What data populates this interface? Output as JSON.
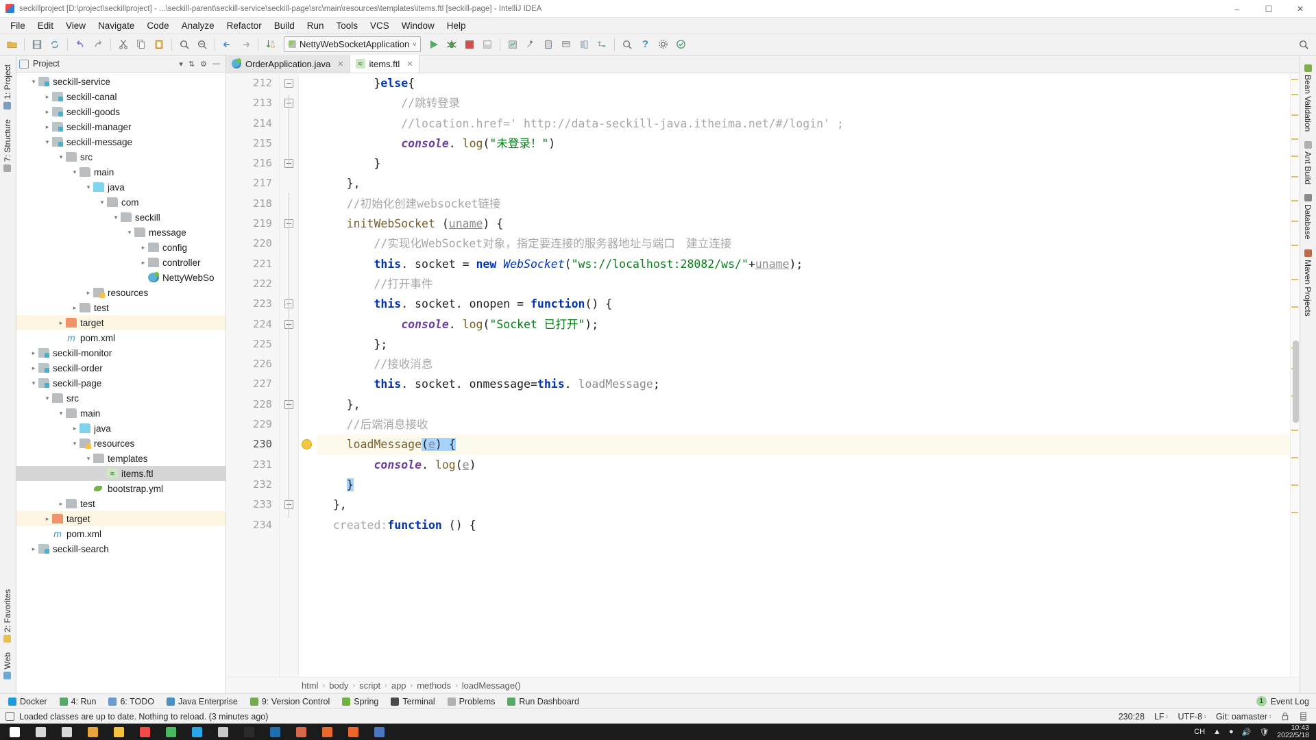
{
  "window": {
    "title": "seckillproject [D:\\project\\seckillproject] - ...\\seckill-parent\\seckill-service\\seckill-page\\src\\main\\resources\\templates\\items.ftl [seckill-page] - IntelliJ IDEA",
    "minimize": "–",
    "maximize": "☐",
    "close": "✕",
    "app_icon": "intellij-logo-icon"
  },
  "menubar": {
    "items": [
      {
        "label": "File"
      },
      {
        "label": "Edit"
      },
      {
        "label": "View"
      },
      {
        "label": "Navigate"
      },
      {
        "label": "Code"
      },
      {
        "label": "Analyze"
      },
      {
        "label": "Refactor"
      },
      {
        "label": "Build"
      },
      {
        "label": "Run"
      },
      {
        "label": "Tools"
      },
      {
        "label": "VCS"
      },
      {
        "label": "Window"
      },
      {
        "label": "Help"
      }
    ]
  },
  "toolbar": {
    "icons": [
      "open-folder-icon",
      "save-all-icon",
      "sync-icon",
      "undo-icon",
      "redo-icon",
      "cut-icon",
      "copy-icon",
      "paste-icon",
      "find-icon",
      "replace-icon",
      "back-icon",
      "forward-icon",
      "sort-icon"
    ],
    "run_config": {
      "label": "NettyWebSocketApplication",
      "dropdown": "˅",
      "icon": "run-config-icon"
    },
    "right_icons": [
      "run-icon",
      "debug-icon",
      "stop-icon",
      "coverage-icon",
      "profile-icon",
      "build-icon",
      "avd-icon",
      "sdk-icon",
      "layout-icon",
      "structure-icon",
      "search-everywhere-icon",
      "help-icon",
      "settings-icon",
      "inspect-icon"
    ],
    "search_icon": "magnifier-icon"
  },
  "left_rail": {
    "tabs": [
      {
        "label": "1: Project",
        "icon": "project-rail-icon"
      },
      {
        "label": "7: Structure",
        "icon": "structure-rail-icon"
      },
      {
        "label": "Web",
        "icon": "web-rail-icon"
      },
      {
        "label": "2: Favorites",
        "icon": "favorites-rail-icon"
      }
    ]
  },
  "right_rail": {
    "tabs": [
      {
        "label": "Bean Validation",
        "icon": "bean-validation-icon"
      },
      {
        "label": "Ant Build",
        "icon": "ant-build-icon"
      },
      {
        "label": "Database",
        "icon": "database-icon"
      },
      {
        "label": "Maven Projects",
        "icon": "maven-icon"
      }
    ]
  },
  "project_panel": {
    "title": "Project",
    "icon": "project-panel-icon",
    "actions": [
      "collapse-all-icon",
      "settings-icon",
      "hide-icon"
    ],
    "tree": [
      {
        "indent": 2,
        "chev": "down",
        "icon": "mod",
        "label": "seckill-service",
        "state": ""
      },
      {
        "indent": 3,
        "chev": "right",
        "icon": "mod",
        "label": "seckill-canal",
        "state": ""
      },
      {
        "indent": 3,
        "chev": "right",
        "icon": "mod",
        "label": "seckill-goods",
        "state": ""
      },
      {
        "indent": 3,
        "chev": "right",
        "icon": "mod",
        "label": "seckill-manager",
        "state": ""
      },
      {
        "indent": 3,
        "chev": "down",
        "icon": "mod",
        "label": "seckill-message",
        "state": ""
      },
      {
        "indent": 4,
        "chev": "down",
        "icon": "folder",
        "label": "src",
        "state": ""
      },
      {
        "indent": 5,
        "chev": "down",
        "icon": "folder",
        "label": "main",
        "state": ""
      },
      {
        "indent": 6,
        "chev": "down",
        "icon": "folderblue",
        "label": "java",
        "state": ""
      },
      {
        "indent": 7,
        "chev": "down",
        "icon": "folder",
        "label": "com",
        "state": ""
      },
      {
        "indent": 8,
        "chev": "down",
        "icon": "folder",
        "label": "seckill",
        "state": ""
      },
      {
        "indent": 9,
        "chev": "down",
        "icon": "folder",
        "label": "message",
        "state": ""
      },
      {
        "indent": 10,
        "chev": "right",
        "icon": "folder",
        "label": "config",
        "state": ""
      },
      {
        "indent": 10,
        "chev": "right",
        "icon": "folder",
        "label": "controller",
        "state": ""
      },
      {
        "indent": 10,
        "chev": "none",
        "icon": "java",
        "label": "NettyWebSo",
        "state": ""
      },
      {
        "indent": 6,
        "chev": "right",
        "icon": "res",
        "label": "resources",
        "state": ""
      },
      {
        "indent": 5,
        "chev": "right",
        "icon": "folder",
        "label": "test",
        "state": ""
      },
      {
        "indent": 4,
        "chev": "right",
        "icon": "orange",
        "label": "target",
        "state": "highlight"
      },
      {
        "indent": 4,
        "chev": "none",
        "icon": "pom",
        "label": "pom.xml",
        "state": ""
      },
      {
        "indent": 2,
        "chev": "right",
        "icon": "mod",
        "label": "seckill-monitor",
        "state": ""
      },
      {
        "indent": 2,
        "chev": "right",
        "icon": "mod",
        "label": "seckill-order",
        "state": ""
      },
      {
        "indent": 2,
        "chev": "down",
        "icon": "mod",
        "label": "seckill-page",
        "state": ""
      },
      {
        "indent": 3,
        "chev": "down",
        "icon": "folder",
        "label": "src",
        "state": ""
      },
      {
        "indent": 4,
        "chev": "down",
        "icon": "folder",
        "label": "main",
        "state": ""
      },
      {
        "indent": 5,
        "chev": "right",
        "icon": "folderblue",
        "label": "java",
        "state": ""
      },
      {
        "indent": 5,
        "chev": "down",
        "icon": "res",
        "label": "resources",
        "state": ""
      },
      {
        "indent": 6,
        "chev": "down",
        "icon": "folder",
        "label": "templates",
        "state": ""
      },
      {
        "indent": 7,
        "chev": "none",
        "icon": "ftl",
        "label": "items.ftl",
        "state": "selected"
      },
      {
        "indent": 6,
        "chev": "none",
        "icon": "yml",
        "label": "bootstrap.yml",
        "state": ""
      },
      {
        "indent": 4,
        "chev": "right",
        "icon": "folder",
        "label": "test",
        "state": ""
      },
      {
        "indent": 3,
        "chev": "right",
        "icon": "orange",
        "label": "target",
        "state": "highlight"
      },
      {
        "indent": 3,
        "chev": "none",
        "icon": "pom",
        "label": "pom.xml",
        "state": ""
      },
      {
        "indent": 2,
        "chev": "right",
        "icon": "mod",
        "label": "seckill-search",
        "state": ""
      }
    ]
  },
  "editor": {
    "tabs": [
      {
        "label": "OrderApplication.java",
        "icon": "java",
        "active": false,
        "close": "✕"
      },
      {
        "label": "items.ftl",
        "icon": "ftl",
        "active": true,
        "close": "✕"
      }
    ],
    "first_line_number": 212,
    "current_line": 230,
    "lines": [
      {
        "n": 212,
        "html": "<span class='tk-plain'>        }</span><span class='tk-kw'>else</span><span class='tk-plain'>{</span>"
      },
      {
        "n": 213,
        "html": "<span class='tk-cm'>            //跳转登录</span>"
      },
      {
        "n": 214,
        "html": "<span class='tk-cm'>            //location.href=' http://data-seckill-java.itheima.net/#/login' ;</span>"
      },
      {
        "n": 215,
        "html": "<span class='tk-plain'>            </span><span class='tk-con'>console</span><span class='tk-plain'>. </span><span class='tk-fn'>log</span><span class='tk-plain'>(</span><span class='tk-str'>\"未登录！\"</span><span class='tk-plain'>)</span>"
      },
      {
        "n": 216,
        "html": "<span class='tk-plain'>        }</span>"
      },
      {
        "n": 217,
        "html": "<span class='tk-plain'>    },</span>"
      },
      {
        "n": 218,
        "html": "<span class='tk-cm'>    //初始化创建websocket链接</span>"
      },
      {
        "n": 219,
        "html": "<span class='tk-plain'>    </span><span class='tk-fn'>initWebSocket</span><span class='tk-plain'> (</span><span class='tk-field tk-ul'>uname</span><span class='tk-plain'>) {</span>"
      },
      {
        "n": 220,
        "html": "<span class='tk-cm'>        //实现化WebSocket对象，指定要连接的服务器地址与端口　建立连接</span>"
      },
      {
        "n": 221,
        "html": "<span class='tk-plain'>        </span><span class='tk-kw'>this</span><span class='tk-plain'>. socket = </span><span class='tk-kw'>new</span><span class='tk-plain'> </span><span class='tk-cls'>WebSocket</span><span class='tk-plain'>(</span><span class='tk-str'>\"ws://localhost:28082/ws/\"</span><span class='tk-plain'>+</span><span class='tk-field tk-ul'>uname</span><span class='tk-plain'>);</span>"
      },
      {
        "n": 222,
        "html": "<span class='tk-cm'>        //打开事件</span>"
      },
      {
        "n": 223,
        "html": "<span class='tk-plain'>        </span><span class='tk-kw'>this</span><span class='tk-plain'>. socket. </span><span class='tk-plain'>onopen = </span><span class='tk-kw'>function</span><span class='tk-plain'>() {</span>"
      },
      {
        "n": 224,
        "html": "<span class='tk-plain'>            </span><span class='tk-con'>console</span><span class='tk-plain'>. </span><span class='tk-fn'>log</span><span class='tk-plain'>(</span><span class='tk-str'>\"Socket 已打开\"</span><span class='tk-plain'>);</span>"
      },
      {
        "n": 225,
        "html": "<span class='tk-plain'>        };</span>"
      },
      {
        "n": 226,
        "html": "<span class='tk-cm'>        //接收消息</span>"
      },
      {
        "n": 227,
        "html": "<span class='tk-plain'>        </span><span class='tk-kw'>this</span><span class='tk-plain'>. socket. onmessage=</span><span class='tk-kw'>this</span><span class='tk-plain'>. </span><span class='tk-field'>loadMessage</span><span class='tk-plain'>;</span>"
      },
      {
        "n": 228,
        "html": "<span class='tk-plain'>    },</span>"
      },
      {
        "n": 229,
        "html": "<span class='tk-cm'>    //后端消息接收</span>"
      },
      {
        "n": 230,
        "html": "<span class='tk-plain'>    </span><span class='tk-fn'>loadMessage</span><span class='sel tk-plain'>(</span><span class='sel tk-field tk-ul'>e</span><span class='sel tk-plain'>) {</span>"
      },
      {
        "n": 231,
        "html": "<span class='tk-plain'>        </span><span class='tk-con'>console</span><span class='tk-plain'>. </span><span class='tk-fn'>log</span><span class='tk-plain'>(</span><span class='tk-field tk-ul'>e</span><span class='tk-plain'>)</span>"
      },
      {
        "n": 232,
        "html": "<span class='tk-plain'>    </span><span class='sel tk-plain'>}</span>"
      },
      {
        "n": 233,
        "html": "<span class='tk-plain'>  },</span>"
      },
      {
        "n": 234,
        "html": "<span class='tk-cm'>  created:</span><span class='tk-kw'>function</span><span class='tk-plain'> () {</span>"
      }
    ],
    "intention_bulb": "intention-bulb-icon",
    "breadcrumbs": [
      "html",
      "body",
      "script",
      "app",
      "methods",
      "loadMessage()"
    ],
    "breadcrumb_sep": "›"
  },
  "bottom_toolwindows": {
    "items": [
      {
        "label": "Docker",
        "num": "",
        "icon": "docker-icon",
        "color": "#1d9bd7"
      },
      {
        "label": "4: Run",
        "num": "4",
        "icon": "run-icon",
        "color": "#59a869"
      },
      {
        "label": "6: TODO",
        "num": "6",
        "icon": "todo-icon",
        "color": "#6b9bd2"
      },
      {
        "label": "Java Enterprise",
        "num": "",
        "icon": "java-enterprise-icon",
        "color": "#4a90c4"
      },
      {
        "label": "9: Version Control",
        "num": "9",
        "icon": "version-control-icon",
        "color": "#7aa84f"
      },
      {
        "label": "Spring",
        "num": "",
        "icon": "spring-icon",
        "color": "#6db33f"
      },
      {
        "label": "Terminal",
        "num": "",
        "icon": "terminal-icon",
        "color": "#4a4a4a"
      },
      {
        "label": "Problems",
        "num": "",
        "icon": "problems-icon",
        "color": "#b0b0b0"
      },
      {
        "label": "Run Dashboard",
        "num": "",
        "icon": "run-dashboard-icon",
        "color": "#59a869"
      }
    ],
    "event_log": {
      "label": "Event Log",
      "count": "1",
      "icon": "event-log-icon"
    }
  },
  "statusbar": {
    "message": "Loaded classes are up to date. Nothing to reload. (3 minutes ago)",
    "message_icon": "console-icon",
    "caret_position": "230:28",
    "line_separator": "LF",
    "encoding": "UTF-8",
    "branch": "Git: oamaster",
    "lock_icon": "lock-icon",
    "inspector_icon": "inspector-icon",
    "caret_glyph": "↕"
  },
  "taskbar": {
    "buttons": [
      {
        "name": "start-button",
        "color": "#ffffff"
      },
      {
        "name": "search-button",
        "color": "#d8d8d8"
      },
      {
        "name": "task-view-button",
        "color": "#d8d8d8"
      },
      {
        "name": "chrome-icon",
        "color": "#e8a33d"
      },
      {
        "name": "file-explorer-icon",
        "color": "#f5c242"
      },
      {
        "name": "intellij-icon",
        "color": "#f24a4a"
      },
      {
        "name": "wechat-icon",
        "color": "#49b85f"
      },
      {
        "name": "qq-icon",
        "color": "#2aa5e8"
      },
      {
        "name": "notes-icon",
        "color": "#c9c9c9"
      },
      {
        "name": "terminal-icon",
        "color": "#2b2b2b"
      },
      {
        "name": "photoshop-icon",
        "color": "#1f6fb0"
      },
      {
        "name": "navicat-icon",
        "color": "#d7684a"
      },
      {
        "name": "firefox-icon",
        "color": "#e8692d"
      },
      {
        "name": "postman-icon",
        "color": "#f06529"
      },
      {
        "name": "editor-icon",
        "color": "#4a76c4"
      }
    ],
    "tray": {
      "ime": "CH",
      "icons": [
        "up-arrow-icon",
        "network-icon",
        "volume-icon",
        "shield-icon"
      ],
      "time": "10:43",
      "date": "2022/5/18"
    }
  }
}
